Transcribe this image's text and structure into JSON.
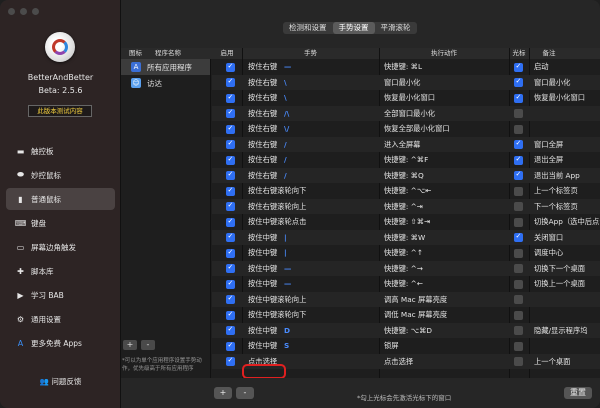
{
  "app": {
    "name": "BetterAndBetter",
    "version": "Beta: 2.5.6",
    "beta_note": "此版本测试内容"
  },
  "sidebar": {
    "items": [
      {
        "label": "触控板",
        "icon": "trackpad-icon"
      },
      {
        "label": "妙控鼠标",
        "icon": "magic-mouse-icon"
      },
      {
        "label": "普通鼠标",
        "icon": "mouse-icon"
      },
      {
        "label": "键盘",
        "icon": "keyboard-icon"
      },
      {
        "label": "屏幕边角触发",
        "icon": "screen-corner-icon"
      },
      {
        "label": "脚本库",
        "icon": "puzzle-icon"
      },
      {
        "label": "学习 BAB",
        "icon": "play-icon"
      },
      {
        "label": "通用设置",
        "icon": "gear-icon"
      },
      {
        "label": "更多免费 Apps",
        "icon": "app-store-icon"
      }
    ],
    "active_index": 2,
    "feedback": "问题反馈"
  },
  "tabs": [
    {
      "label": "检测和设置"
    },
    {
      "label": "手势设置"
    },
    {
      "label": "平滑滚轮"
    }
  ],
  "apps_pane": {
    "headers": {
      "icon": "图标",
      "name": "程序名称"
    },
    "items": [
      {
        "name": "所有应用程序"
      },
      {
        "name": "访达"
      }
    ],
    "note": "*可以为单个应用程序设置手势动作，优先级高于所有应用程序",
    "add": "+",
    "remove": "-"
  },
  "table": {
    "headers": {
      "enable": "启用",
      "gesture": "手势",
      "action": "执行动作",
      "cursor": "光标",
      "remark": "备注"
    },
    "rows": [
      {
        "enabled": true,
        "gesture": "按住右键",
        "glyph": "—",
        "action": "快捷键: ⌘L",
        "cursor": true,
        "remark": "启动"
      },
      {
        "enabled": true,
        "gesture": "按住右键",
        "glyph": "\\",
        "action": "窗口最小化",
        "cursor": true,
        "remark": "窗口最小化"
      },
      {
        "enabled": true,
        "gesture": "按住右键",
        "glyph": "\\",
        "action": "恢复最小化窗口",
        "cursor": true,
        "remark": "恢复最小化窗口"
      },
      {
        "enabled": true,
        "gesture": "按住右键",
        "glyph": "/\\",
        "action": "全部窗口最小化",
        "cursor": false,
        "remark": ""
      },
      {
        "enabled": true,
        "gesture": "按住右键",
        "glyph": "\\/",
        "action": "恢复全部最小化窗口",
        "cursor": false,
        "remark": ""
      },
      {
        "enabled": true,
        "gesture": "按住右键",
        "glyph": "/",
        "action": "进入全屏幕",
        "cursor": true,
        "remark": "窗口全屏"
      },
      {
        "enabled": true,
        "gesture": "按住右键",
        "glyph": "/",
        "action": "快捷键: ^⌘F",
        "cursor": true,
        "remark": "退出全屏"
      },
      {
        "enabled": true,
        "gesture": "按住右键",
        "glyph": "/",
        "action": "快捷键: ⌘Q",
        "cursor": true,
        "remark": "退出当前 App"
      },
      {
        "enabled": true,
        "gesture": "按住右键滚轮向下",
        "glyph": "",
        "action": "快捷键: ^⌥⇤",
        "cursor": false,
        "remark": "上一个标签页"
      },
      {
        "enabled": true,
        "gesture": "按住右键滚轮向上",
        "glyph": "",
        "action": "快捷键: ^⇥",
        "cursor": false,
        "remark": "下一个标签页"
      },
      {
        "enabled": true,
        "gesture": "按住中键滚轮点击",
        "glyph": "",
        "action": "快捷键: ⇧⌘⇥",
        "cursor": false,
        "remark": "切换App（选中后点击）"
      },
      {
        "enabled": true,
        "gesture": "按住中键",
        "glyph": "|",
        "action": "快捷键: ⌘W",
        "cursor": true,
        "remark": "关闭窗口"
      },
      {
        "enabled": true,
        "gesture": "按住中键",
        "glyph": "|",
        "action": "快捷键: ^↑",
        "cursor": false,
        "remark": "调度中心"
      },
      {
        "enabled": true,
        "gesture": "按住中键",
        "glyph": "—",
        "action": "快捷键: ^→",
        "cursor": false,
        "remark": "切换下一个桌面"
      },
      {
        "enabled": true,
        "gesture": "按住中键",
        "glyph": "—",
        "action": "快捷键: ^←",
        "cursor": false,
        "remark": "切换上一个桌面"
      },
      {
        "enabled": true,
        "gesture": "按住中键滚轮向上",
        "glyph": "",
        "action": "调高 Mac 屏幕亮度",
        "cursor": false,
        "remark": ""
      },
      {
        "enabled": true,
        "gesture": "按住中键滚轮向下",
        "glyph": "",
        "action": "调低 Mac 屏幕亮度",
        "cursor": false,
        "remark": ""
      },
      {
        "enabled": true,
        "gesture": "按住中键",
        "glyph": "D",
        "action": "快捷键: ⌥⌘D",
        "cursor": false,
        "remark": "隐藏/显示程序坞"
      },
      {
        "enabled": true,
        "gesture": "按住中键",
        "glyph": "S",
        "action": "锁屏",
        "cursor": false,
        "remark": ""
      },
      {
        "enabled": true,
        "gesture": "点击选择",
        "glyph": "",
        "action": "点击选择",
        "cursor": false,
        "remark": "上一个桌面"
      }
    ]
  },
  "footer": {
    "add": "+",
    "remove": "-",
    "note": "*勾上光标会先激活光标下的窗口",
    "reset": "重置"
  },
  "colors": {
    "accent": "#2f6ff3",
    "highlight": "#e02020",
    "beta_text": "#f4d03f"
  }
}
